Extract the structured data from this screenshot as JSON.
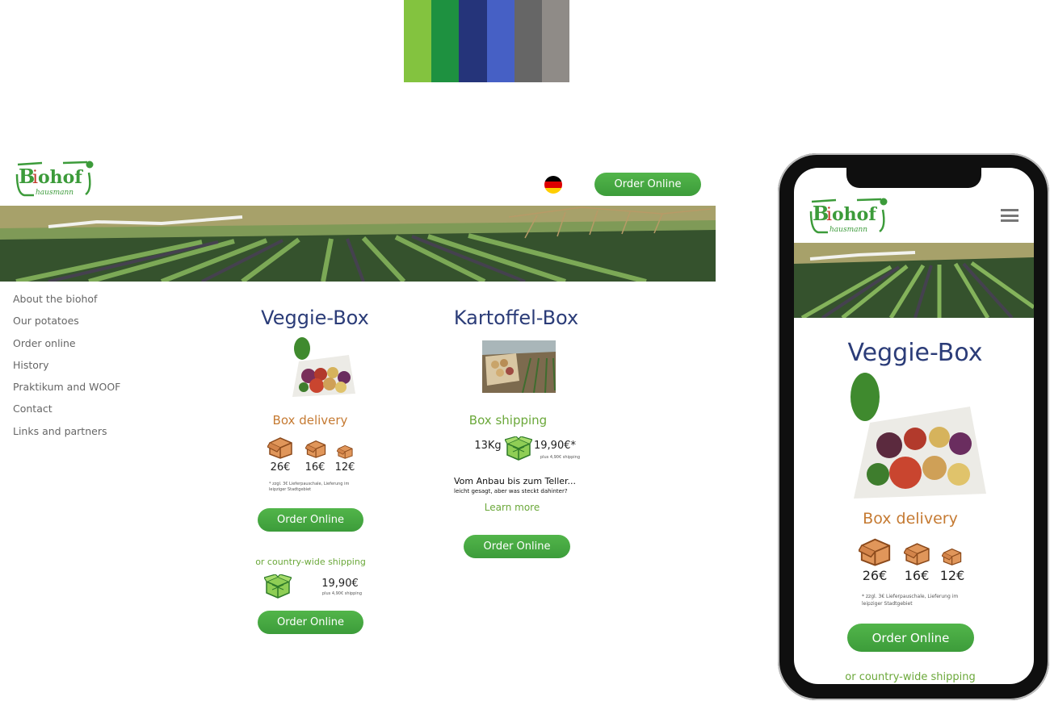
{
  "palette": [
    "#83c33f",
    "#1e9140",
    "#25347a",
    "#4660c5",
    "#666666",
    "#8f8b87"
  ],
  "logo": {
    "brand": "Biohof",
    "sub": "hausmann"
  },
  "header": {
    "order_btn": "Order Online",
    "language_flag": "german-flag-icon"
  },
  "nav": {
    "items": [
      "About the biohof",
      "Our potatoes",
      "Order online",
      "History",
      "Praktikum and WOOF",
      "Contact",
      "Links and partners"
    ]
  },
  "veggie": {
    "title": "Veggie-Box",
    "delivery_title": "Box delivery",
    "prices": [
      "26€",
      "16€",
      "12€"
    ],
    "fine_print": "* zzgl. 3€ Lieferpauschale, Lieferung im leipziger Stadtgebiet",
    "order_btn": "Order Online",
    "countrywide": "or country-wide shipping",
    "ship_price": "19,90€",
    "ship_fine": "plus 4,90€ shipping",
    "order_btn2": "Order Online"
  },
  "kartoffel": {
    "title": "Kartoffel-Box",
    "shipping_title": "Box shipping",
    "weight": "13Kg",
    "price": "19,90€*",
    "price_fine": "plus 4,90€ shipping",
    "teaser_title": "Vom Anbau bis zum Teller...",
    "teaser_sub": "leicht gesagt, aber was steckt dahinter?",
    "learn_more": "Learn more",
    "order_btn": "Order Online"
  },
  "mobile": {
    "menu_icon": "hamburger-menu-icon",
    "title": "Veggie-Box",
    "delivery_title": "Box delivery",
    "prices": [
      "26€",
      "16€",
      "12€"
    ],
    "fine_print": "* zzgl. 3€ Lieferpauschale, Lieferung im leipziger Stadtgebiet",
    "order_btn": "Order Online",
    "countrywide": "or country-wide shipping"
  },
  "colors": {
    "brand_green": "#4aab45",
    "title_blue": "#2b3c78",
    "orange": "#c57a32",
    "light_green": "#6ba83a"
  }
}
